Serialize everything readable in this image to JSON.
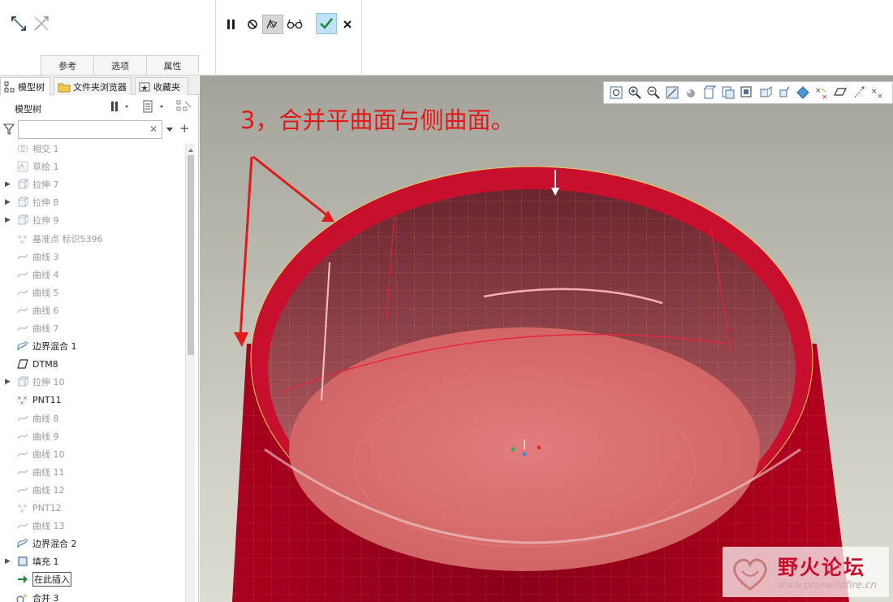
{
  "ribbon": {
    "tabs": [
      "参考",
      "选项",
      "属性"
    ],
    "group1_icons": [
      "swap-direction-icon",
      "swap-direction-alt-icon"
    ],
    "group2_icons": [
      "pause-icon",
      "no-preview-icon",
      "verify-preview-icon",
      "glasses-preview-icon",
      "confirm-check-icon",
      "cancel-x-icon"
    ]
  },
  "panel": {
    "tabs": [
      "模型树",
      "文件夹浏览器",
      "收藏夹"
    ],
    "title": "模型树",
    "search_placeholder": ""
  },
  "tree": {
    "items": [
      {
        "label": "相交 1",
        "icon": "intersect-icon",
        "dim": true,
        "expand": ""
      },
      {
        "label": "草绘 1",
        "icon": "sketch-icon",
        "dim": true,
        "expand": ""
      },
      {
        "label": "拉伸 7",
        "icon": "extrude-icon",
        "dim": true,
        "expand": "▶"
      },
      {
        "label": "拉伸 8",
        "icon": "extrude-icon",
        "dim": true,
        "expand": "▶"
      },
      {
        "label": "拉伸 9",
        "icon": "extrude-icon",
        "dim": true,
        "expand": "▶"
      },
      {
        "label": "基准点 标识5396",
        "icon": "datum-point-icon",
        "dim": true,
        "expand": ""
      },
      {
        "label": "曲线 3",
        "icon": "curve-icon",
        "dim": true,
        "expand": ""
      },
      {
        "label": "曲线 4",
        "icon": "curve-icon",
        "dim": true,
        "expand": ""
      },
      {
        "label": "曲线 5",
        "icon": "curve-icon",
        "dim": true,
        "expand": ""
      },
      {
        "label": "曲线 6",
        "icon": "curve-icon",
        "dim": true,
        "expand": ""
      },
      {
        "label": "曲线 7",
        "icon": "curve-icon",
        "dim": true,
        "expand": ""
      },
      {
        "label": "边界混合 1",
        "icon": "boundary-blend-icon",
        "dim": false,
        "expand": ""
      },
      {
        "label": "DTM8",
        "icon": "datum-plane-icon",
        "dim": false,
        "expand": ""
      },
      {
        "label": "拉伸 10",
        "icon": "extrude-icon",
        "dim": true,
        "expand": "▶"
      },
      {
        "label": "PNT11",
        "icon": "datum-point-icon",
        "dim": false,
        "expand": ""
      },
      {
        "label": "曲线 8",
        "icon": "curve-icon",
        "dim": true,
        "expand": ""
      },
      {
        "label": "曲线 9",
        "icon": "curve-icon",
        "dim": true,
        "expand": ""
      },
      {
        "label": "曲线 10",
        "icon": "curve-icon",
        "dim": true,
        "expand": ""
      },
      {
        "label": "曲线 11",
        "icon": "curve-icon",
        "dim": true,
        "expand": ""
      },
      {
        "label": "曲线 12",
        "icon": "curve-icon",
        "dim": true,
        "expand": ""
      },
      {
        "label": "PNT12",
        "icon": "datum-point-icon",
        "dim": true,
        "expand": ""
      },
      {
        "label": "曲线 13",
        "icon": "curve-icon",
        "dim": true,
        "expand": ""
      },
      {
        "label": "边界混合 2",
        "icon": "boundary-blend-icon",
        "dim": false,
        "expand": ""
      },
      {
        "label": "填充 1",
        "icon": "fill-icon",
        "dim": false,
        "expand": "▶"
      },
      {
        "label": "在此插入",
        "icon": "insert-here-arrow-icon",
        "dim": false,
        "expand": ""
      },
      {
        "label": "合并 3",
        "icon": "merge-icon",
        "dim": false,
        "expand": ""
      }
    ]
  },
  "viewport": {
    "annotation": "3，合并平曲面与侧曲面。",
    "view_toolbar_icons": [
      "refit-icon",
      "zoom-in-icon",
      "zoom-out-icon",
      "repaint-icon",
      "display-style-icon",
      "saved-orientations-icon",
      "view-manager-icon",
      "perspective-icon",
      "section-icon",
      "appearance-icon",
      "datum-display-icon",
      "plane-display-icon",
      "axis-display-icon",
      "point-display-icon",
      "csys-display-icon"
    ]
  },
  "watermark": {
    "title": "野火论坛",
    "url": "www.proewildfire.cn"
  },
  "colors": {
    "model_red": "#c8102e",
    "annotation_red": "#e01b1b",
    "confirm_check": "#1f8a3a"
  }
}
